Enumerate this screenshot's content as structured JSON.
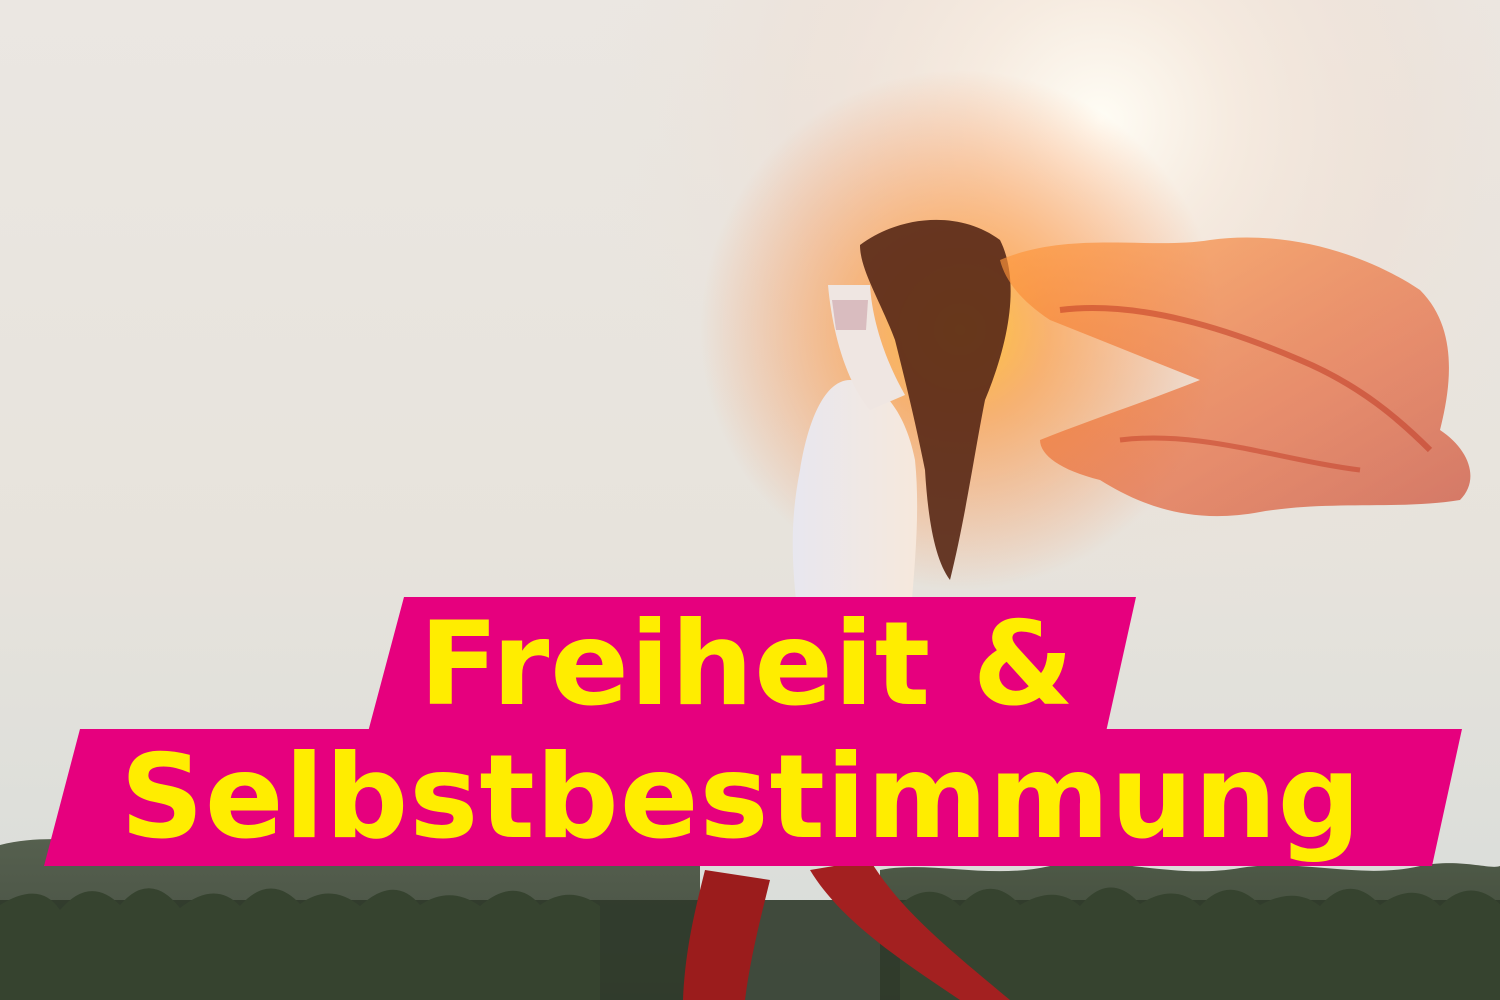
{
  "headline": {
    "line1": "Freiheit &",
    "line2": "Selbstbestimmung"
  },
  "colors": {
    "banner_bg": "#e6007e",
    "banner_text": "#ffed00"
  },
  "photo": {
    "icon": "woman-with-scarf-illustration"
  }
}
